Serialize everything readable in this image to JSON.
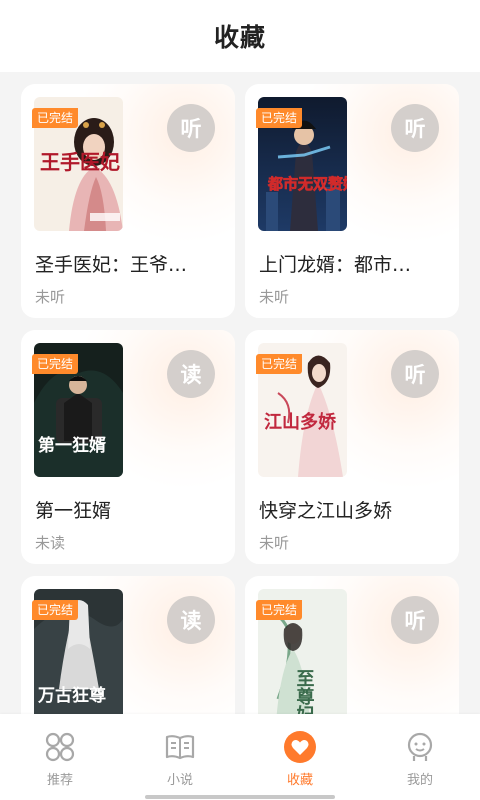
{
  "header": {
    "title": "收藏"
  },
  "books": [
    {
      "badge": "已完结",
      "action": "听",
      "title": "圣手医妃：王爷…",
      "status": "未听",
      "cover_text": "王手医妃"
    },
    {
      "badge": "已完结",
      "action": "听",
      "title": "上门龙婿：都市…",
      "status": "未听",
      "cover_text": "都市无双赘婿"
    },
    {
      "badge": "已完结",
      "action": "读",
      "title": "第一狂婿",
      "status": "未读",
      "cover_text": "第一狂婿"
    },
    {
      "badge": "已完结",
      "action": "听",
      "title": "快穿之江山多娇",
      "status": "未听",
      "cover_text": "江山多娇"
    },
    {
      "badge": "已完结",
      "action": "读",
      "title": "",
      "status": "",
      "cover_text": "万古狂尊"
    },
    {
      "badge": "已完结",
      "action": "听",
      "title": "",
      "status": "",
      "cover_text": "至尊妃"
    }
  ],
  "tabbar": {
    "items": [
      {
        "label": "推荐",
        "icon": "grid-icon"
      },
      {
        "label": "小说",
        "icon": "book-icon"
      },
      {
        "label": "收藏",
        "icon": "heart-icon",
        "active": true
      },
      {
        "label": "我的",
        "icon": "user-icon"
      }
    ]
  },
  "colors": {
    "accent": "#ff7a2c",
    "badge": "#ff8a2b",
    "action_circle": "#d4cfcc"
  }
}
